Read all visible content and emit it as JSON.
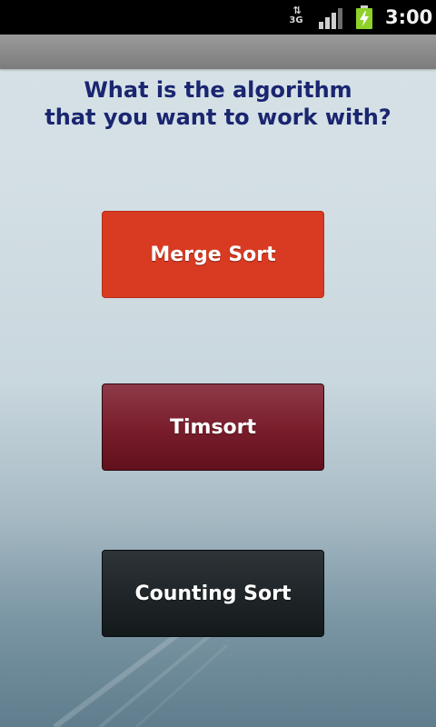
{
  "status_bar": {
    "network_label": "3G",
    "clock": "3:00",
    "signal_icon": "signal-bars-icon",
    "battery_icon": "battery-charging-icon",
    "battery_color": "#8ed129"
  },
  "question": {
    "line1": "What is the algorithm",
    "line2": "that you want to work with?"
  },
  "buttons": {
    "merge_sort": "Merge Sort",
    "timsort": "Timsort",
    "counting_sort": "Counting Sort"
  },
  "colors": {
    "question_text": "#1a2670",
    "merge_sort_bg": "#d93a22",
    "timsort_bg": "#781c2a",
    "counting_sort_bg": "#1d2326"
  }
}
